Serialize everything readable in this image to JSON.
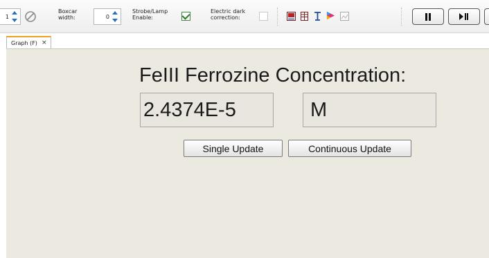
{
  "toolbar": {
    "scans_value": "1",
    "boxcar_label_1": "Boxcar",
    "boxcar_label_2": "width:",
    "boxcar_value": "0",
    "strobe_label_1": "Strobe/Lamp",
    "strobe_label_2": "Enable:",
    "strobe_checked": true,
    "dark_label_1": "Electric dark",
    "dark_label_2": "correction:",
    "dark_checked": false,
    "tools": [
      "graph-icon",
      "table-icon",
      "text-cursor-icon",
      "color-icon",
      "image-icon"
    ],
    "pause_icon": "pause-icon",
    "step_icon": "play-pause-icon"
  },
  "tabs": [
    {
      "label": "Graph (F)",
      "close": "×"
    }
  ],
  "main": {
    "title": "FeIII Ferrozine Concentration:",
    "value": "2.4374E-5",
    "unit": "M",
    "single_update": "Single Update",
    "continuous_update": "Continuous Update"
  },
  "colors": {
    "panel_bg": "#ece9e0",
    "tab_accent": "#f0a020",
    "spinner_arrow": "#2a6fb8"
  }
}
